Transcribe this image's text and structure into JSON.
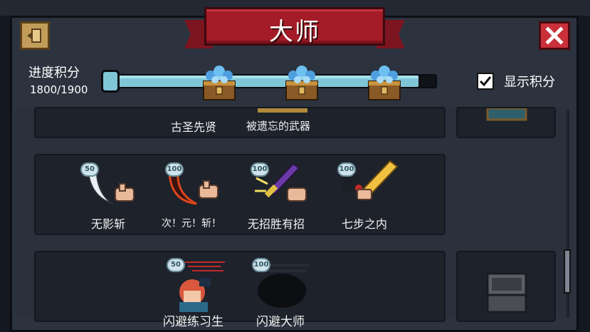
{
  "header": {
    "title": "大师"
  },
  "progress": {
    "label": "进度积分",
    "value_text": "1800/1900",
    "fraction": 0.947
  },
  "show_points": {
    "label": "显示积分",
    "checked": true
  },
  "icons": {
    "exit": "exit-door-icon",
    "close": "close-x-icon",
    "chest": "gem-chest-icon",
    "check": "checkmark-icon"
  },
  "colors": {
    "ribbon_red": "#a31c27",
    "close_red": "#c9303a",
    "progress_blue": "#7fc6d6",
    "exit_tan": "#c29d5a"
  },
  "rows": [
    {
      "items": [
        {
          "name": "古圣先贤"
        },
        {
          "name": "被遗忘的武器"
        }
      ]
    },
    {
      "items": [
        {
          "name": "无影斩",
          "points": "50"
        },
        {
          "name": "次！元！斩！",
          "points": "100"
        },
        {
          "name": "无招胜有招",
          "points": "100"
        },
        {
          "name": "七步之内",
          "points": "100"
        }
      ]
    },
    {
      "items": [
        {
          "name": "闪避练习生",
          "points": "50"
        },
        {
          "name": "闪避大师",
          "points": "100"
        }
      ]
    }
  ]
}
